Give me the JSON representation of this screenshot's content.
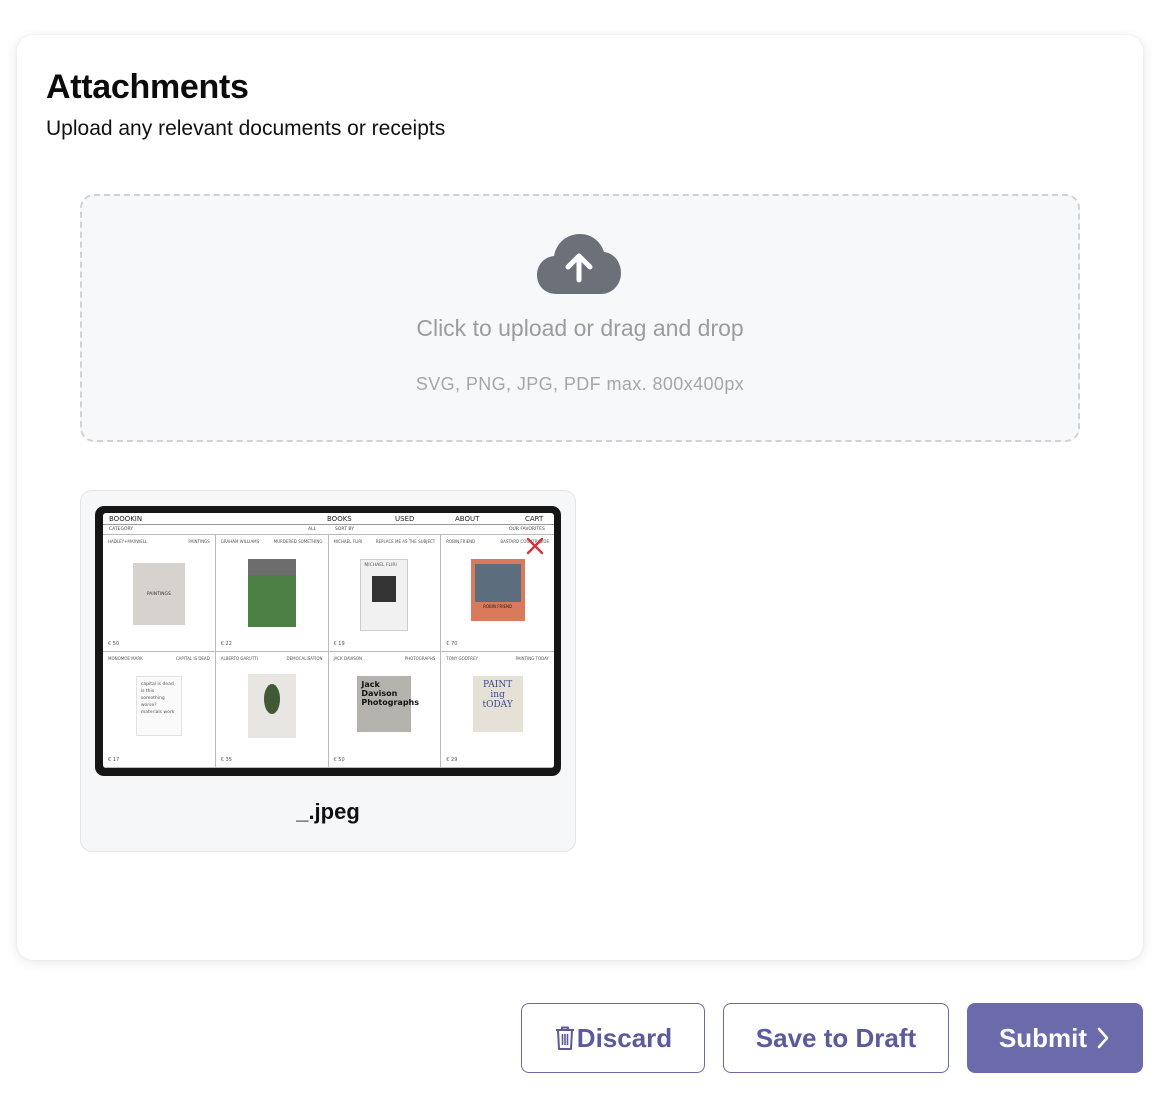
{
  "section": {
    "title": "Attachments",
    "subtitle": "Upload any relevant documents or receipts"
  },
  "dropzone": {
    "icon": "cloud-upload-icon",
    "main_text": "Click to upload or drag and drop",
    "hint_text": "SVG, PNG, JPG, PDF max. 800x400px"
  },
  "attachments": [
    {
      "filename": "_.jpeg",
      "thumbnail": {
        "brand": "BOOOKIN",
        "nav": [
          "BOOKS",
          "USED",
          "ABOUT",
          "CART"
        ],
        "filters": {
          "category": "CATEGORY",
          "all": "ALL",
          "sort": "SORT BY",
          "favorites": "OUR FAVORITES"
        },
        "products": [
          {
            "author": "HADLEY+MAXWELL",
            "title": "PAINTINGS",
            "price": "€ 50",
            "cover_text": "PAINTINGS"
          },
          {
            "author": "GRAHAM WILLIAMS",
            "title": "MURDERED SOMETHING",
            "price": "€ 22",
            "cover_text": ""
          },
          {
            "author": "MICHAEL FLIRI",
            "title": "REPLACE ME AS THE SUBJECT",
            "price": "€ 19",
            "cover_text": "MICHAEL FLIRI"
          },
          {
            "author": "ROBIN FRIEND",
            "title": "BASTARD COUNTRYSIDE",
            "price": "€ 70",
            "cover_text": "ROBIN FRIEND"
          },
          {
            "author": "MONOMOE MARK",
            "title": "CAPITAL IS DEAD",
            "price": "€ 17",
            "cover_text": "capital is dead is this something worse? materials work"
          },
          {
            "author": "ALBERTO GARUTTI",
            "title": "DEMOCALISATION",
            "price": "€ 35",
            "cover_text": ""
          },
          {
            "author": "JACK DAVISON",
            "title": "PHOTOGRAPHS",
            "price": "€ 50",
            "cover_text": "Jack Davison Photographs"
          },
          {
            "author": "TONY GODFREY",
            "title": "PAINTING TODAY",
            "price": "€ 29",
            "cover_text": "PAINT ing tODAY"
          }
        ]
      }
    }
  ],
  "actions": {
    "discard": "Discard",
    "save_draft": "Save to Draft",
    "submit": "Submit"
  },
  "colors": {
    "accent": "#6b6aab",
    "accent_text": "#5b5a9c",
    "dropzone_bg": "#f7f8fa",
    "dropzone_border": "#d0d2d6"
  }
}
